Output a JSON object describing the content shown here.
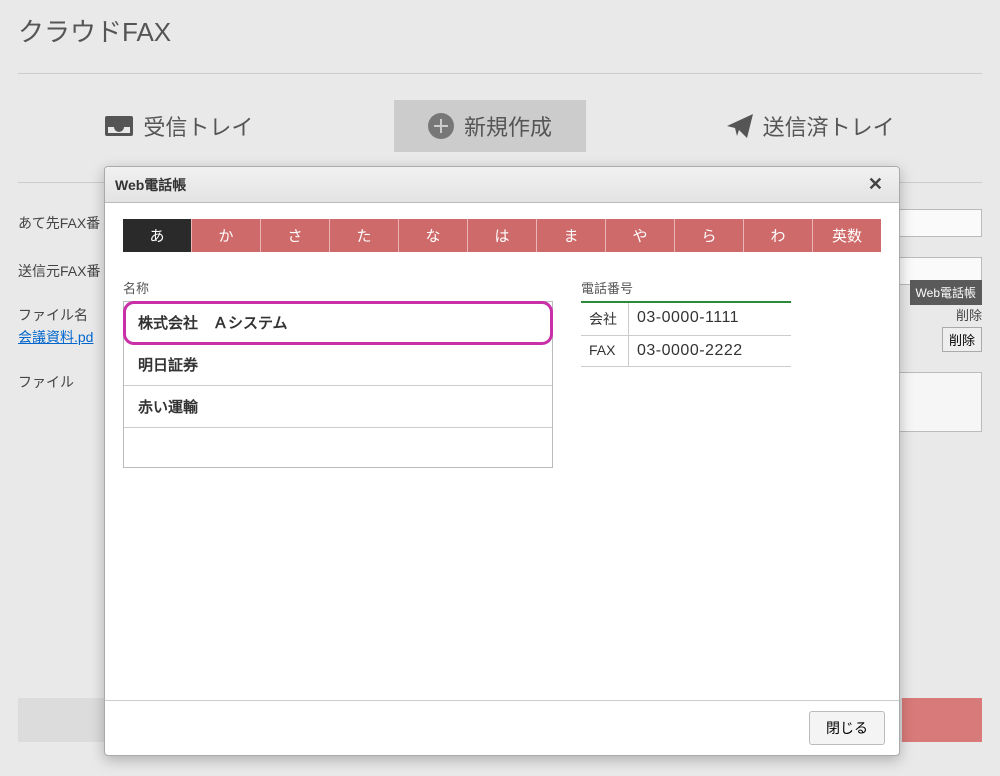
{
  "header": {
    "title": "クラウドFAX"
  },
  "tabs": {
    "inbox": "受信トレイ",
    "new": "新規作成",
    "sent": "送信済トレイ"
  },
  "form": {
    "to_label": "あて先FAX番",
    "from_label": "送信元FAX番",
    "filename_label": "ファイル名",
    "file_label": "ファイル",
    "web_book_btn": "Web電話帳",
    "delete_head": "削除",
    "delete_btn": "削除",
    "attached_file": "会議資料.pd"
  },
  "modal": {
    "title": "Web電話帳",
    "close_btn": "閉じる",
    "kana_tabs": [
      "あ",
      "か",
      "さ",
      "た",
      "な",
      "は",
      "ま",
      "や",
      "ら",
      "わ",
      "英数"
    ],
    "left_head": "名称",
    "right_head": "電話番号",
    "names": [
      "株式会社　Ａシステム",
      "明日証券",
      "赤い運輸"
    ],
    "phones": [
      {
        "label": "会社",
        "number": "03-0000-1111"
      },
      {
        "label": "FAX",
        "number": "03-0000-2222"
      }
    ]
  }
}
